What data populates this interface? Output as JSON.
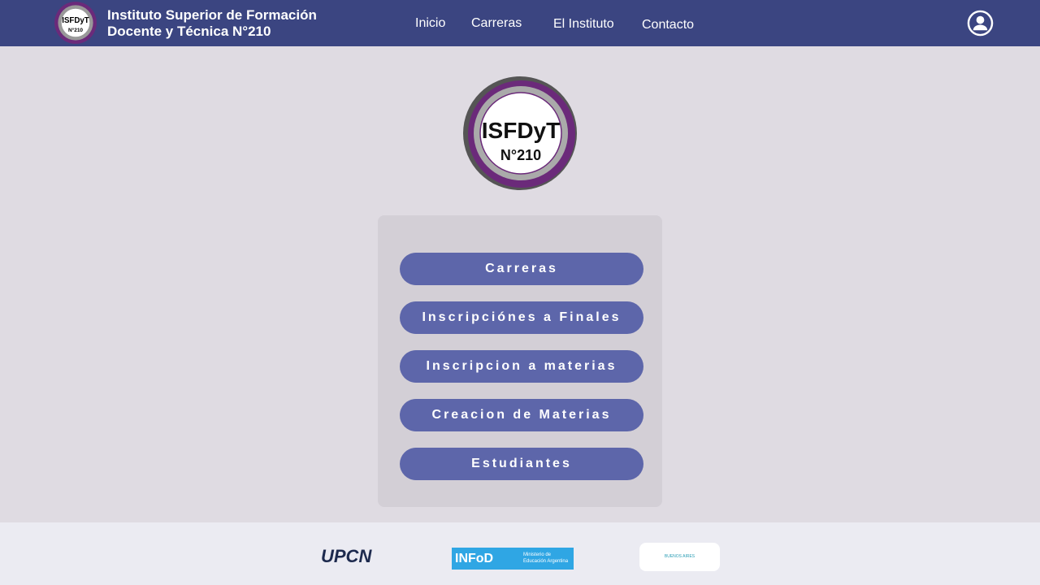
{
  "header": {
    "logo_text": "ISFDyT N°210",
    "title_line1": "Instituto Superior de Formación",
    "title_line2": "Docente y Técnica N°210"
  },
  "nav": [
    {
      "label": "Inicio"
    },
    {
      "label": "Carreras"
    },
    {
      "label": "El Instituto"
    },
    {
      "label": "Contacto"
    }
  ],
  "main_logo": {
    "line1": "ISFDyT",
    "line2": "N°210"
  },
  "menu": [
    {
      "label": "Carreras"
    },
    {
      "label": "Inscripciónes a Finales"
    },
    {
      "label": "Inscripcion a materias"
    },
    {
      "label": "Creacion de Materias"
    },
    {
      "label": "Estudiantes"
    }
  ],
  "footer": {
    "upcn": "UPCN",
    "infod": "INFoD",
    "infod_ministry": "Ministerio de Educación Argentina",
    "pba": "BUENOS AIRES"
  }
}
